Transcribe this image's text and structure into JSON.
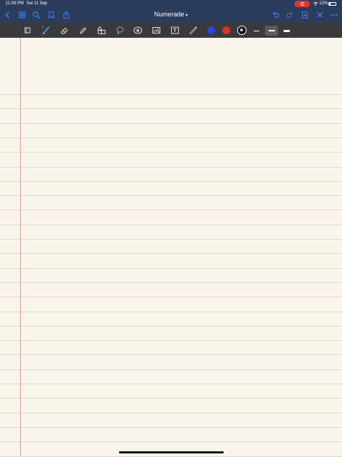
{
  "status": {
    "time": "11:08 PM",
    "date": "Sat 11 Sep",
    "battery": "12%"
  },
  "nav": {
    "title": "Numerade"
  },
  "colors": {
    "blue": "#2a46e0",
    "red": "#e0302a",
    "black": "#111111",
    "accent": "#3b82f6"
  },
  "toolbar": {
    "tools": [
      "page-icon",
      "pen-icon",
      "eraser-icon",
      "highlighter-icon",
      "shapes-icon",
      "lasso-icon",
      "sticker-icon",
      "image-icon",
      "text-icon",
      "laser-pointer-icon"
    ],
    "selected_tool": "pen-icon",
    "selected_color": "black",
    "selected_stroke": "medium"
  }
}
